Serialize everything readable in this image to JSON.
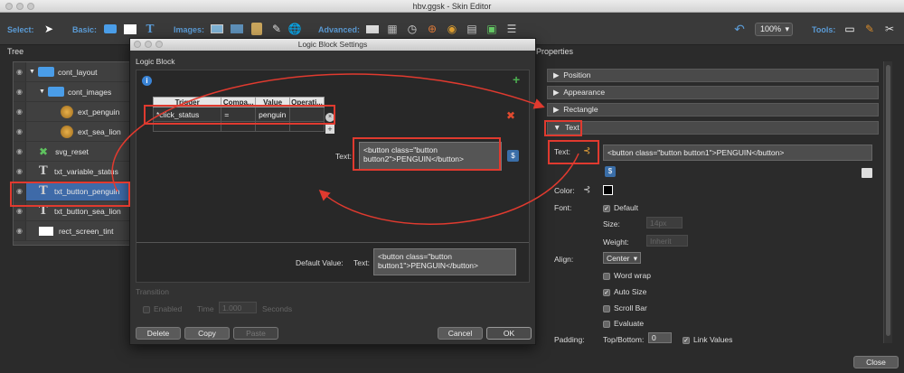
{
  "window": {
    "title": "hbv.ggsk - Skin Editor"
  },
  "toolbar": {
    "select_label": "Select:",
    "basic_label": "Basic:",
    "images_label": "Images:",
    "advanced_label": "Advanced:",
    "zoom": "100%",
    "tools_label": "Tools:"
  },
  "tree": {
    "header": "Tree",
    "items": [
      {
        "label": "cont_layout",
        "icon": "folder-icon"
      },
      {
        "label": "cont_images",
        "icon": "folder-icon"
      },
      {
        "label": "ext_penguin",
        "icon": "image-icon"
      },
      {
        "label": "ext_sea_lion",
        "icon": "image-icon"
      },
      {
        "label": "svg_reset",
        "icon": "svg-icon"
      },
      {
        "label": "txt_variable_status",
        "icon": "text-icon"
      },
      {
        "label": "txt_button_penguin",
        "icon": "text-icon"
      },
      {
        "label": "txt_button_sea_lion",
        "icon": "text-icon"
      },
      {
        "label": "rect_screen_tint",
        "icon": "rect-icon"
      }
    ]
  },
  "dialog": {
    "title": "Logic Block Settings",
    "logic_block_label": "Logic Block",
    "columns": [
      "Trigger",
      "Compa...",
      "Value",
      "Operati..."
    ],
    "rows": [
      {
        "trigger": "*click_status",
        "compare": "=",
        "value": "penguin",
        "operation": ""
      }
    ],
    "text_label": "Text:",
    "text_value": "<button class=\"button button2\">PENGUIN</button>",
    "default_value_label": "Default Value:",
    "default_text_label": "Text:",
    "default_text_value": "<button class=\"button button1\">PENGUIN</button>",
    "transition_label": "Transition",
    "enabled_label": "Enabled",
    "time_label": "Time",
    "time_value": "1.000",
    "seconds_label": "Seconds",
    "delete_button": "Delete",
    "copy_button": "Copy",
    "paste_button": "Paste",
    "cancel_button": "Cancel",
    "ok_button": "OK"
  },
  "properties": {
    "header": "Properties",
    "sections": [
      "Position",
      "Appearance",
      "Rectangle",
      "Text"
    ],
    "text_label": "Text:",
    "text_value": "<button class=\"button button1\">PENGUIN</button>",
    "color_label": "Color:",
    "font_label": "Font:",
    "default_label": "Default",
    "size_label": "Size:",
    "size_value": "14px",
    "weight_label": "Weight:",
    "weight_value": "Inherit",
    "align_label": "Align:",
    "align_value": "Center",
    "word_wrap_label": "Word wrap",
    "auto_size_label": "Auto Size",
    "scroll_bar_label": "Scroll Bar",
    "evaluate_label": "Evaluate",
    "padding_label": "Padding:",
    "top_bottom_label": "Top/Bottom:",
    "padding_value": "0",
    "link_values_label": "Link Values",
    "close_button": "Close"
  },
  "colors": {
    "accent": "#3e6aa8",
    "annotation": "#e03a2f",
    "add": "#4caf50",
    "remove": "#e04a2f"
  }
}
